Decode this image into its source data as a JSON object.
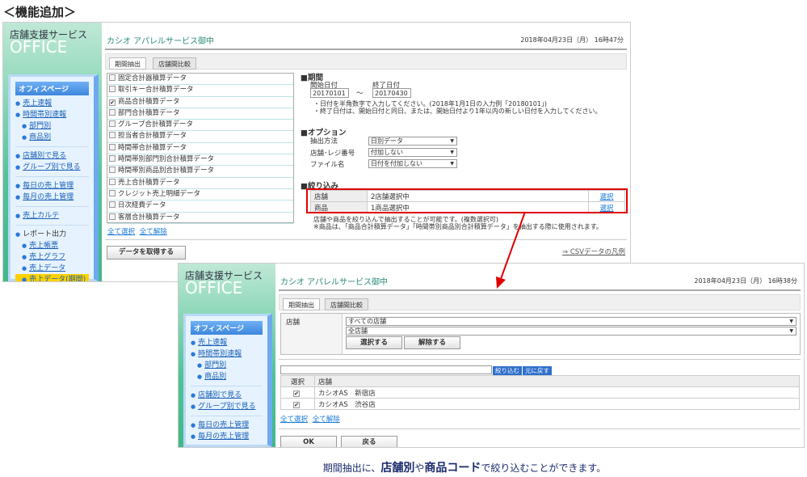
{
  "heading": "＜機能追加＞",
  "brand": {
    "line1": "店舗支援サービス",
    "line2": "OFFICE"
  },
  "sidebar": {
    "header": "オフィスページ",
    "items": [
      "売上速報",
      "時間帯別速報",
      "部門別",
      "商品別",
      "店舗別で見る",
      "グループ別で見る",
      "毎日の売上管理",
      "毎月の売上管理",
      "売上カルテ",
      "レポート出力",
      "売上帳票",
      "売上グラフ",
      "売上データ",
      "売上データ(期間)"
    ]
  },
  "screen1": {
    "title": "カシオ アパレルサービス御中",
    "date": "2018年04月23日（月） 16時47分",
    "tabs": [
      "期間抽出",
      "店舗間比較"
    ],
    "data_types": [
      {
        "label": "固定合計器積算データ",
        "checked": false
      },
      {
        "label": "取引キー合計積算データ",
        "checked": false
      },
      {
        "label": "商品合計積算データ",
        "checked": true
      },
      {
        "label": "部門合計積算データ",
        "checked": false
      },
      {
        "label": "グループ合計積算データ",
        "checked": false
      },
      {
        "label": "担当者合計積算データ",
        "checked": false
      },
      {
        "label": "時間帯合計積算データ",
        "checked": false
      },
      {
        "label": "時間帯別部門別合計積算データ",
        "checked": false
      },
      {
        "label": "時間帯別商品別合計積算データ",
        "checked": false
      },
      {
        "label": "売上合計積算データ",
        "checked": false
      },
      {
        "label": "クレジット売上明細データ",
        "checked": false
      },
      {
        "label": "日次経費データ",
        "checked": false
      },
      {
        "label": "客層合計積算データ",
        "checked": false
      }
    ],
    "select_all": "全て選択",
    "deselect_all": "全て解除",
    "get_data": "データを取得する",
    "period": {
      "title": "■期間",
      "start_label": "開始日付",
      "start": "20170101",
      "tilde": "～",
      "end_label": "終了日付",
      "end": "20170430",
      "note1": "・日付を半角数字で入力してください。(2018年1月1日の入力例「20180101」)",
      "note2": "・終了日付は、開始日付と同日、または、開始日付より1年以内の新しい日付を入力してください。"
    },
    "options": {
      "title": "■オプション",
      "rows": [
        {
          "label": "抽出方法",
          "value": "日別データ"
        },
        {
          "label": "店舗･レジ番号",
          "value": "付加しない"
        },
        {
          "label": "ファイル名",
          "value": "日付を付加しない"
        }
      ]
    },
    "filter": {
      "title": "■絞り込み",
      "rows": [
        {
          "label": "店舗",
          "value": "2店舗選択中",
          "action": "選択"
        },
        {
          "label": "商品",
          "value": "1商品選択中",
          "action": "選択"
        }
      ],
      "note1": "店舗や商品を絞り込んで抽出することが可能です。(複数選択可)",
      "note2": "※商品は、「商品合計積算データ」「時間帯別商品別合計積算データ」を抽出する際に使用されます。"
    },
    "csv_link": "⇒ CSVデータの凡例"
  },
  "screen2": {
    "title": "カシオ アパレルサービス御中",
    "date": "2018年04月23日（月） 16時38分",
    "tabs": [
      "期間抽出",
      "店舗間比較"
    ],
    "store_label": "店舗",
    "select1": "すべての店舗",
    "select2": "全店舗",
    "select_btn": "選択する",
    "clear_btn": "解除する",
    "filter_btn": "絞り込む",
    "reset_btn": "元に戻す",
    "table_headers": [
      "選択",
      "店舗"
    ],
    "rows": [
      {
        "checked": true,
        "store": "カシオAS　新宿店"
      },
      {
        "checked": true,
        "store": "カシオAS　渋谷店"
      }
    ],
    "select_all": "全て選択",
    "deselect_all": "全て解除",
    "ok": "OK",
    "back": "戻る"
  },
  "caption": {
    "part1": "期間抽出に、",
    "bold1": "店舗別",
    "part2": "や",
    "bold2": "商品コード",
    "part3": "で絞り込むことができます。"
  },
  "colors": {
    "highlight_box": "#e00000",
    "arrow": "#e00000",
    "accent_green": "#52c497",
    "menu_blue": "#3d86dc"
  }
}
